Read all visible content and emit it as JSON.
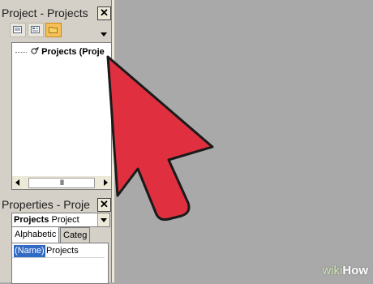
{
  "project_panel": {
    "title": "Project - Projects",
    "close_label": "✕",
    "toolbar": {
      "buttons": [
        {
          "name": "view-code"
        },
        {
          "name": "view-object"
        },
        {
          "name": "toggle-folders",
          "active": true
        }
      ]
    },
    "tree": {
      "root_label": "Projects (Proje"
    },
    "scrollbar": {
      "thumb_label": "III"
    }
  },
  "properties_panel": {
    "title": "Properties - Proje",
    "close_label": "✕",
    "object_combo": {
      "name": "Projects",
      "type": "Project"
    },
    "tabs": [
      {
        "label": "Alphabetic",
        "selected": true
      },
      {
        "label": "Categ",
        "selected": false
      }
    ],
    "rows": [
      {
        "name": "(Name)",
        "value": "Projects"
      }
    ]
  },
  "watermark": {
    "wiki": "wiki",
    "how": "How"
  },
  "colors": {
    "workspace": "#a9a9a9",
    "arrow": "#e0303f",
    "selection": "#316ac5",
    "active_tool": "#f5c05a"
  },
  "icons": {
    "arrow": "pointer-arrow-icon",
    "tree_node": "vba-project-icon",
    "folder": "folder-icon"
  }
}
